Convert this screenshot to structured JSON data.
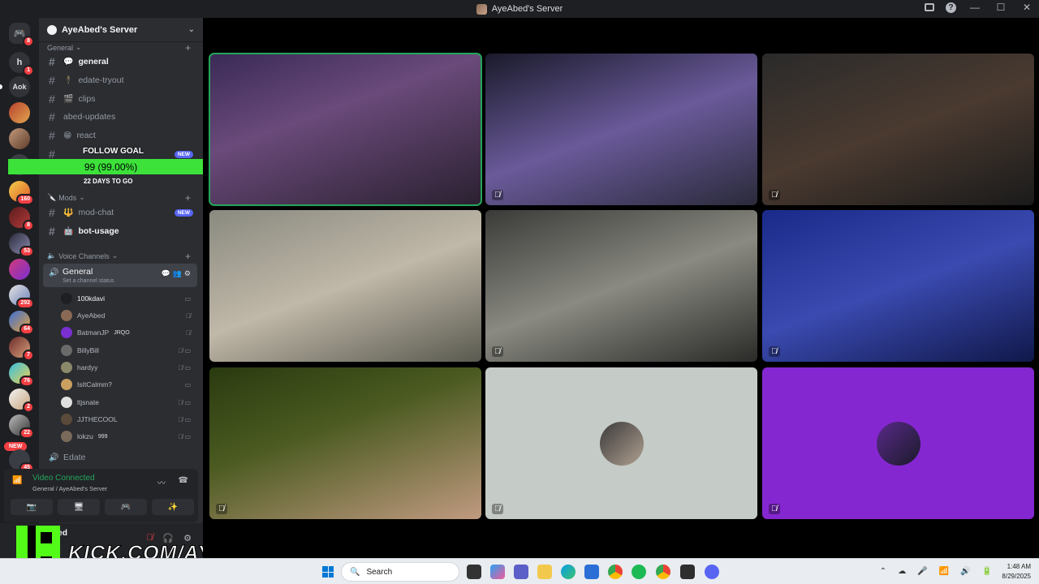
{
  "window": {
    "title": "AyeAbed's Server"
  },
  "server_rail": {
    "text_servers": [
      "h",
      "Aok"
    ],
    "badges": [
      "8",
      "1",
      "160",
      "8",
      "53",
      "292",
      "64",
      "7",
      "76",
      "2",
      "22",
      "45"
    ],
    "new_label": "NEW"
  },
  "guild": {
    "name": "AyeAbed's Server"
  },
  "categories": {
    "general": "General",
    "mods": "Mods",
    "voice": "Voice Channels"
  },
  "text_channels": [
    {
      "name": "general",
      "emoji": "💬"
    },
    {
      "name": "edate-tryout",
      "emoji": "🕴"
    },
    {
      "name": "clips",
      "emoji": "🎬"
    },
    {
      "name": "abed-updates",
      "emoji": ""
    },
    {
      "name": "react",
      "emoji": "😁"
    }
  ],
  "new_tag": "NEW",
  "follow_goal": {
    "title": "FOLLOW GOAL",
    "bar_text": "99 (99.00%)",
    "progress": 0.99,
    "days_left": "22 DAYS TO GO",
    "target": "100"
  },
  "mod_channels": [
    {
      "name": "mod-chat",
      "emoji": "🔱"
    },
    {
      "name": "bot-usage",
      "emoji": "🤖"
    }
  ],
  "voice_channel": {
    "name": "General",
    "status": "Set a channel status"
  },
  "members": [
    {
      "name": "100kdavi",
      "tag": "",
      "icons": "▭"
    },
    {
      "name": "AyeAbed",
      "tag": "",
      "icons": "🎙̸"
    },
    {
      "name": "BatmanJP",
      "tag": "JRQO",
      "icons": "🎙̸"
    },
    {
      "name": "BillyBill",
      "tag": "",
      "icons": "🎙̸ ▭"
    },
    {
      "name": "hardyy",
      "tag": "",
      "icons": "🎙̸ ▭"
    },
    {
      "name": "IsItCalmm?",
      "tag": "",
      "icons": "▭"
    },
    {
      "name": "ltjsnate",
      "tag": "",
      "icons": "🎙̸ ▭"
    },
    {
      "name": "JJTHECOOL",
      "tag": "",
      "icons": "🎙̸ ▭"
    },
    {
      "name": "lokzu",
      "tag": "999",
      "icons": "🎙̸ ▭"
    }
  ],
  "edate_channel": "Edate",
  "voice_panel": {
    "status": "Video Connected",
    "location": "General / AyeAbed's Server"
  },
  "user_panel": {
    "name": "AyeAbed"
  },
  "kick": {
    "url": "KICK.COM/AYEABED"
  },
  "taskbar": {
    "search_placeholder": "Search",
    "time": "1:48 AM",
    "date": "8/29/2025"
  },
  "colors": {
    "accent_green": "#23a55a",
    "goal_green": "#3ce13a",
    "blurple": "#5865f2",
    "danger": "#f23f43"
  }
}
